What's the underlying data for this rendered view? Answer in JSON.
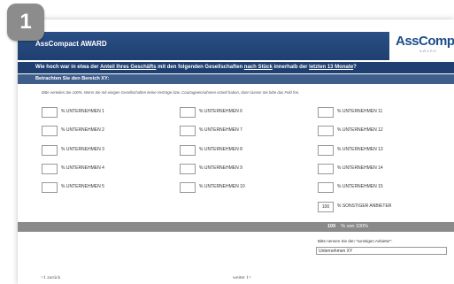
{
  "badge_number": "1",
  "header": {
    "title": "AssCompact AWARD"
  },
  "logo": {
    "text": "AssCompac",
    "sub": "AWARD"
  },
  "question": {
    "p1": "Wie hoch war in etwa der ",
    "u1": "Anteil Ihres Geschäfts",
    "p2": " mit den folgenden Gesellschaften ",
    "u2": "nach Stück",
    "p3": " innerhalb der ",
    "u3": "letzten 13 Monate",
    "p4": "?"
  },
  "subheader": "Betrachten Sie den Bereich XY:",
  "instruction": "Bitte verteilen Sie 100%. Wenn Sie mit einigen Gesellschaften keine Verträge bzw. Courtageeinnahmen erzielt haben, dann lassen Sie bitte das Feld frei.",
  "companies": [
    {
      "label": "% UNTERNEHMEN 1",
      "value": ""
    },
    {
      "label": "% UNTERNEHMEN 2",
      "value": ""
    },
    {
      "label": "% UNTERNEHMEN 3",
      "value": ""
    },
    {
      "label": "% UNTERNEHMEN 4",
      "value": ""
    },
    {
      "label": "% UNTERNEHMEN 5",
      "value": ""
    },
    {
      "label": "% UNTERNEHMEN 6",
      "value": ""
    },
    {
      "label": "% UNTERNEHMEN 7",
      "value": ""
    },
    {
      "label": "% UNTERNEHMEN 8",
      "value": ""
    },
    {
      "label": "% UNTERNEHMEN 9",
      "value": ""
    },
    {
      "label": "% UNTERNEHMEN 10",
      "value": ""
    },
    {
      "label": "% UNTERNEHMEN 11",
      "value": ""
    },
    {
      "label": "% UNTERNEHMEN 12",
      "value": ""
    },
    {
      "label": "% UNTERNEHMEN 13",
      "value": ""
    },
    {
      "label": "% UNTERNEHMEN 14",
      "value": ""
    },
    {
      "label": "% UNTERNEHMEN 15",
      "value": ""
    },
    {
      "label": "% SONSTIGER ANBIETER",
      "value": "100"
    }
  ],
  "total": {
    "value": "100",
    "label": "% von 100%"
  },
  "other_provider": {
    "prompt": "Bitte nennen Sie den \"sonstigen Anbieter\":",
    "value": "Unternehmen XY"
  },
  "nav": {
    "back": "<1 zurück",
    "next": "weiter 1>"
  },
  "colors": {
    "header": "#1f3f70",
    "subheader": "#3f5e8b",
    "total_bar": "#8a8a8a",
    "badge": "#8c8c8c"
  }
}
